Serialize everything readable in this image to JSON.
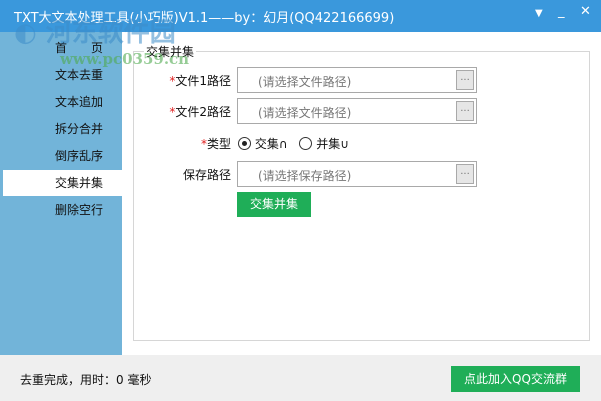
{
  "window": {
    "title": "TXT大文本处理工具(小巧版)V1.1——by：幻月(QQ422166699)",
    "menu_icon": "dropdown-triangle",
    "min_icon": "minimize",
    "close_icon": "close"
  },
  "sidebar": {
    "items": [
      {
        "label": "首　　页"
      },
      {
        "label": "文本去重"
      },
      {
        "label": "文本追加"
      },
      {
        "label": "拆分合并"
      },
      {
        "label": "倒序乱序"
      },
      {
        "label": "交集并集",
        "selected": true
      },
      {
        "label": "删除空行"
      }
    ]
  },
  "main": {
    "group_title": "交集并集",
    "file1": {
      "label": "文件1路径",
      "placeholder": "(请选择文件路径)",
      "browse": "..."
    },
    "file2": {
      "label": "文件2路径",
      "placeholder": "(请选择文件路径)",
      "browse": "..."
    },
    "type": {
      "label": "类型",
      "options": [
        {
          "label": "交集∩",
          "checked": true
        },
        {
          "label": "并集∪",
          "checked": false
        }
      ]
    },
    "save": {
      "label": "保存路径",
      "placeholder": "(请选择保存路径)",
      "browse": "..."
    },
    "required_mark": "*",
    "run_button": "交集并集"
  },
  "status": {
    "text": "去重完成，用时：0 毫秒",
    "qq_button": "点此加入QQ交流群"
  },
  "watermark": {
    "name": "河东软件园",
    "url": "www.pc0359.cn"
  },
  "colors": {
    "title_bar": "#3a98dc",
    "sidebar": "#72b4d9",
    "accent_green": "#1fae58"
  }
}
